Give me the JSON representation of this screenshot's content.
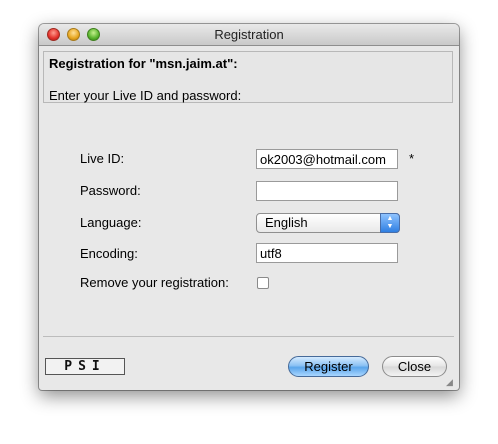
{
  "window": {
    "title": "Registration"
  },
  "header": {
    "title": "Registration for \"msn.jaim.at\":",
    "subtitle": "Enter your Live ID and password:"
  },
  "form": {
    "live_id": {
      "label": "Live ID:",
      "value": "ok2003@hotmail.com",
      "required_mark": "*"
    },
    "password": {
      "label": "Password:",
      "value": ""
    },
    "language": {
      "label": "Language:",
      "value": "English"
    },
    "encoding": {
      "label": "Encoding:",
      "value": "utf8"
    },
    "remove": {
      "label": "Remove your registration:",
      "checked": false
    }
  },
  "footer": {
    "logo_text": "PSI",
    "register_label": "Register",
    "close_label": "Close"
  }
}
